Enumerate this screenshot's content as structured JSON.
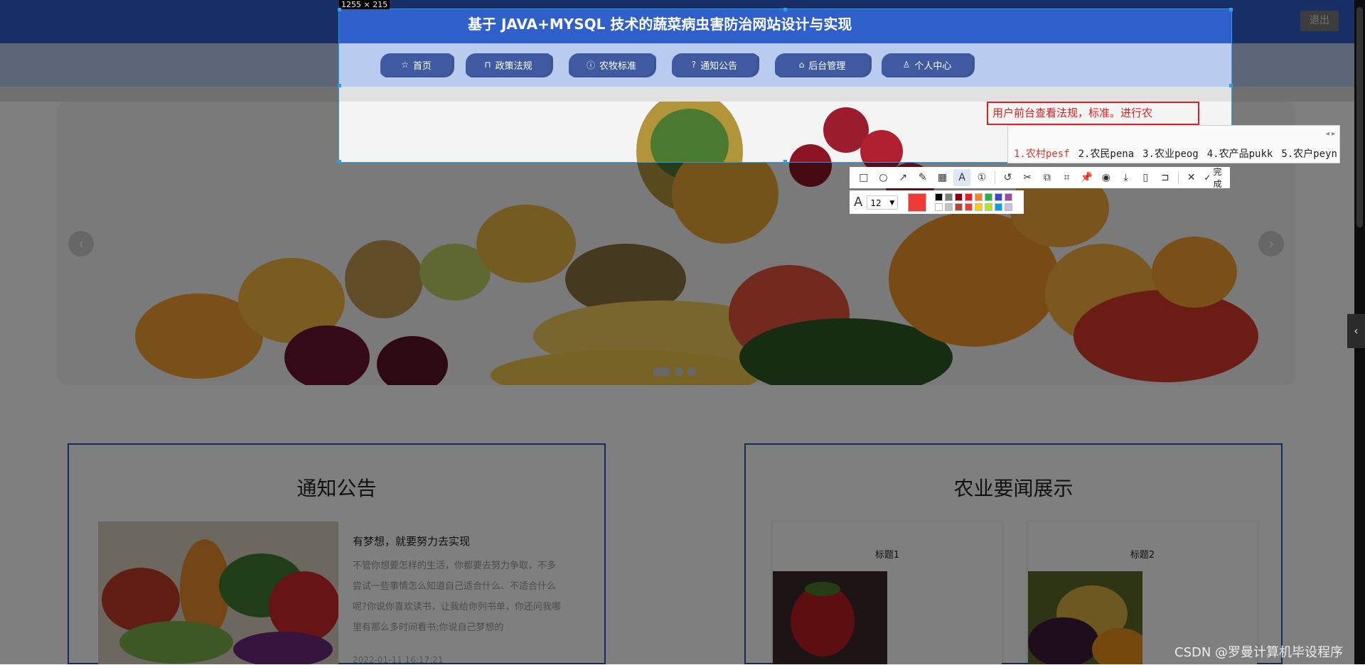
{
  "app": {
    "title": "基于 JAVA+MYSQL 技术的蔬菜病虫害防治网站设计与实现",
    "logout_label": "退出"
  },
  "nav": [
    {
      "label": "首页",
      "icon": "star-icon",
      "glyph": "☆"
    },
    {
      "label": "政策法规",
      "icon": "bag-icon",
      "glyph": "⊓"
    },
    {
      "label": "农牧标准",
      "icon": "info-icon",
      "glyph": "ⓘ"
    },
    {
      "label": "通知公告",
      "icon": "help-icon",
      "glyph": "?"
    },
    {
      "label": "后台管理",
      "icon": "shop-icon",
      "glyph": "⌂"
    },
    {
      "label": "个人中心",
      "icon": "user-icon",
      "glyph": "♙"
    }
  ],
  "banner": {
    "dots": 3,
    "active_dot": 1
  },
  "notice": {
    "title": "通知公告",
    "item": {
      "headline": "有梦想，就要努力去实现",
      "body": "不管你想要怎样的生活，你都要去努力争取，不多尝试一些事情怎么知道自己适合什么、不适合什么呢?你说你喜欢读书，让我给你列书单，你还问我哪里有那么多时间看书;你说自己梦想的",
      "date": "2022-01-11 16:17:21"
    }
  },
  "news": {
    "title": "农业要闻展示",
    "cards": [
      {
        "title": "标题1"
      },
      {
        "title": "标题2"
      }
    ]
  },
  "capture": {
    "size_label": "1255 × 215",
    "annotation_text": "用户前台查看法规，标准。进行农",
    "annotation_color": "#e02020"
  },
  "ime": {
    "candidates": [
      "1.农村pesf",
      "2.农民pena",
      "3.农业peog",
      "4.农产品pukk",
      "5.农户peyn"
    ]
  },
  "toolbar": {
    "tools": [
      {
        "name": "rectangle-tool-icon",
        "glyph": "□"
      },
      {
        "name": "ellipse-tool-icon",
        "glyph": "○"
      },
      {
        "name": "arrow-tool-icon",
        "glyph": "↗"
      },
      {
        "name": "pencil-tool-icon",
        "glyph": "✎"
      },
      {
        "name": "mosaic-tool-icon",
        "glyph": "▦"
      },
      {
        "name": "text-tool-icon",
        "glyph": "A",
        "active": true
      },
      {
        "name": "number-tool-icon",
        "glyph": "①"
      }
    ],
    "actions": [
      {
        "name": "undo-icon",
        "glyph": "↺"
      },
      {
        "name": "scissors-icon",
        "glyph": "✂"
      },
      {
        "name": "copy-text-icon",
        "glyph": "⧉"
      },
      {
        "name": "ocr-icon",
        "glyph": "⌗"
      },
      {
        "name": "pin-icon",
        "glyph": "📌"
      },
      {
        "name": "record-icon",
        "glyph": "◉"
      },
      {
        "name": "download-icon",
        "glyph": "⤓"
      },
      {
        "name": "phone-icon",
        "glyph": "▯"
      },
      {
        "name": "bookmark-icon",
        "glyph": "⊐"
      }
    ],
    "close_glyph": "✕",
    "done_label": "完成"
  },
  "font_settings": {
    "font_icon": "A",
    "size": "12",
    "current_color": "#ef3a36",
    "palette": [
      "#000000",
      "#7f7f7f",
      "#880015",
      "#ed1c24",
      "#ff7f27",
      "#22b14c",
      "#3f48cc",
      "#a349a4",
      "#ffffff",
      "#c3c3c3",
      "#b5442e",
      "#ef3a36",
      "#ffc90e",
      "#b5e61d",
      "#00a2e8",
      "#c8bfe7"
    ]
  },
  "watermark": "CSDN @罗曼计算机毕设程序"
}
